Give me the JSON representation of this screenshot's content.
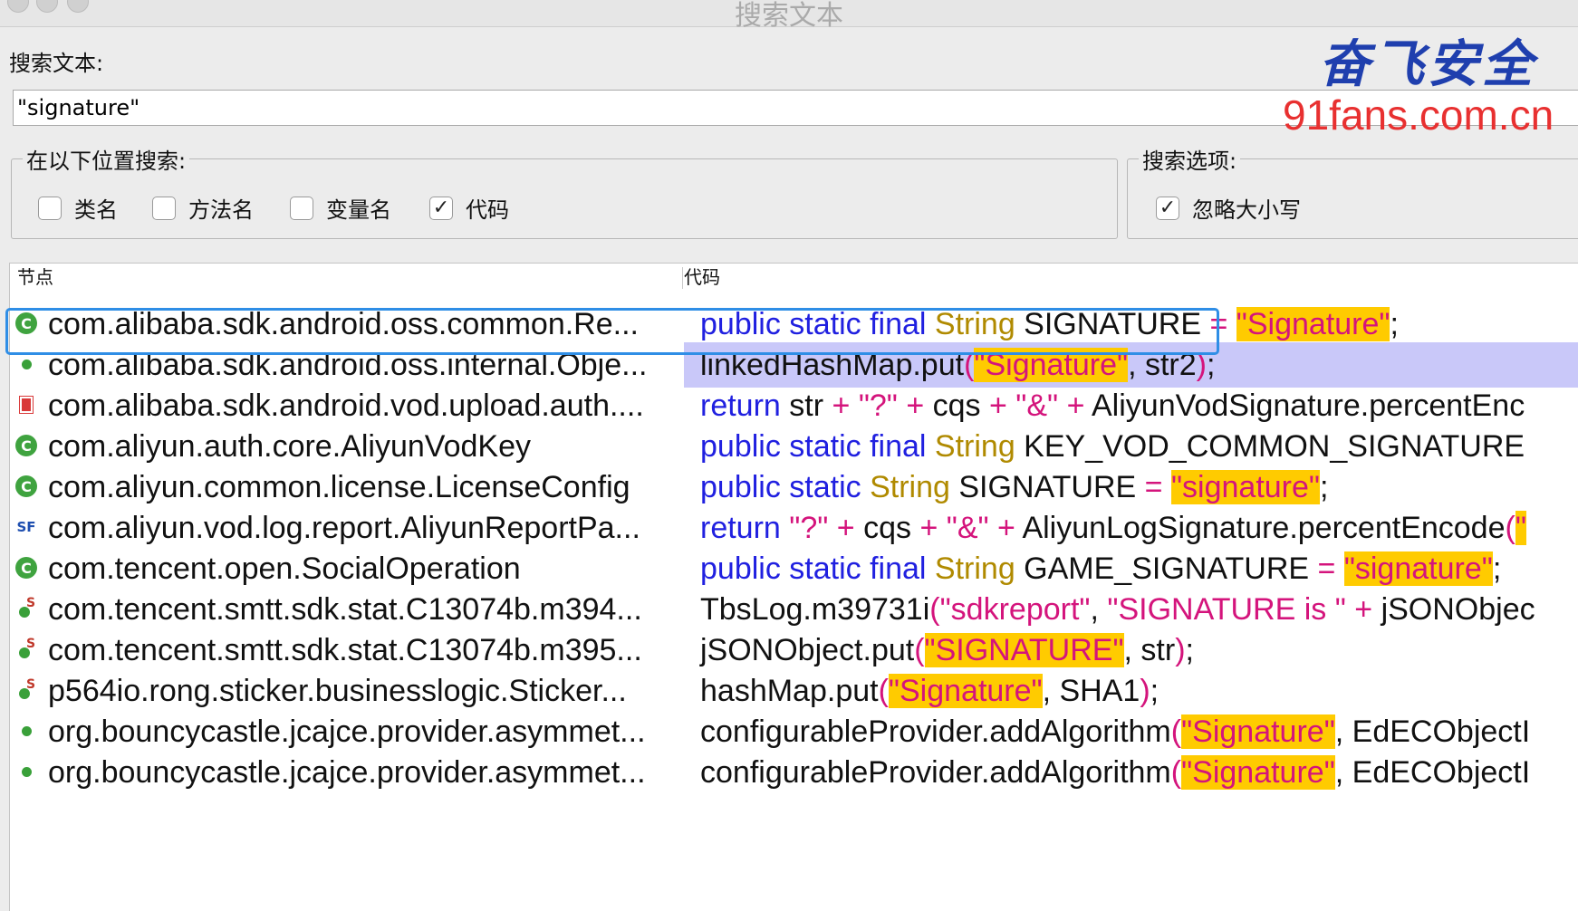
{
  "window": {
    "title": "搜索文本"
  },
  "search": {
    "label": "搜索文本:",
    "value": "\"signature\""
  },
  "watermark": {
    "brand": "奋飞安全",
    "url": "91fans.com.cn"
  },
  "locations": {
    "legend": "在以下位置搜索:",
    "options": [
      {
        "label": "类名",
        "checked": false
      },
      {
        "label": "方法名",
        "checked": false
      },
      {
        "label": "变量名",
        "checked": false
      },
      {
        "label": "代码",
        "checked": true
      }
    ]
  },
  "search_options": {
    "legend": "搜索选项:",
    "options": [
      {
        "label": "忽略大小写",
        "checked": true
      }
    ]
  },
  "colors": {
    "keyword": "#2020e0",
    "type": "#b08a00",
    "string": "#d4147c",
    "match_highlight": "#ffcb00",
    "selected_row": "#c9c8f9",
    "selection_outline": "#2f8ee6"
  },
  "results": {
    "headers": {
      "node": "节点",
      "code": "代码"
    },
    "check_mark": "✓",
    "rows": [
      {
        "node": "com.alibaba.sdk.android.oss.common.Re...",
        "icon": "class-icon",
        "code": [
          [
            "kw",
            "public static final "
          ],
          [
            "type",
            "String"
          ],
          [
            "plain",
            " SIGNATURE "
          ],
          [
            "op",
            "= "
          ],
          [
            "strhl",
            "\"Signature\""
          ],
          [
            "plain",
            ";"
          ]
        ]
      },
      {
        "node": "com.alibaba.sdk.android.oss.internal.Obje...",
        "icon": "method-icon",
        "selected": true,
        "code": [
          [
            "plain",
            "linkedHashMap.put"
          ],
          [
            "op",
            "("
          ],
          [
            "strhl",
            "\"Signature\""
          ],
          [
            "plain",
            ", str2"
          ],
          [
            "op",
            ")"
          ],
          [
            "plain",
            ";"
          ]
        ]
      },
      {
        "node": "com.alibaba.sdk.android.vod.upload.auth....",
        "icon": "private-method-icon",
        "code": [
          [
            "kw",
            "return"
          ],
          [
            "plain",
            " str "
          ],
          [
            "op",
            "+ "
          ],
          [
            "str",
            "\"?\""
          ],
          [
            "op",
            " + "
          ],
          [
            "plain",
            "cqs "
          ],
          [
            "op",
            "+ "
          ],
          [
            "str",
            "\"&\""
          ],
          [
            "op",
            " + "
          ],
          [
            "plain",
            "AliyunVodSignature.percentEnc"
          ]
        ]
      },
      {
        "node": "com.aliyun.auth.core.AliyunVodKey",
        "icon": "class-icon",
        "code": [
          [
            "kw",
            "public static final "
          ],
          [
            "type",
            "String"
          ],
          [
            "plain",
            " KEY_VOD_COMMON_SIGNATURE"
          ]
        ]
      },
      {
        "node": "com.aliyun.common.license.LicenseConfig",
        "icon": "class-icon",
        "code": [
          [
            "kw",
            "public static "
          ],
          [
            "type",
            "String"
          ],
          [
            "plain",
            " SIGNATURE "
          ],
          [
            "op",
            "= "
          ],
          [
            "strhl",
            "\"signature\""
          ],
          [
            "plain",
            ";"
          ]
        ]
      },
      {
        "node": "com.aliyun.vod.log.report.AliyunReportPa...",
        "icon": "static-field-icon",
        "code": [
          [
            "kw",
            "return "
          ],
          [
            "str",
            "\"?\""
          ],
          [
            "op",
            " + "
          ],
          [
            "plain",
            "cqs "
          ],
          [
            "op",
            "+ "
          ],
          [
            "str",
            "\"&\""
          ],
          [
            "op",
            " + "
          ],
          [
            "plain",
            "AliyunLogSignature.percentEncode"
          ],
          [
            "op",
            "("
          ],
          [
            "strhl",
            "\""
          ]
        ]
      },
      {
        "node": "com.tencent.open.SocialOperation",
        "icon": "class-icon",
        "code": [
          [
            "kw",
            "public static final "
          ],
          [
            "type",
            "String"
          ],
          [
            "plain",
            " GAME_SIGNATURE "
          ],
          [
            "op",
            "= "
          ],
          [
            "strhl",
            "\"signature\""
          ],
          [
            "plain",
            ";"
          ]
        ]
      },
      {
        "node": "com.tencent.smtt.sdk.stat.C13074b.m394...",
        "icon": "static-method-icon",
        "code": [
          [
            "plain",
            "TbsLog.m39731i"
          ],
          [
            "op",
            "("
          ],
          [
            "str",
            "\"sdkreport\""
          ],
          [
            "plain",
            ", "
          ],
          [
            "str",
            "\"SIGNATURE is \""
          ],
          [
            "op",
            " + "
          ],
          [
            "plain",
            "jSONObjec"
          ]
        ]
      },
      {
        "node": "com.tencent.smtt.sdk.stat.C13074b.m395...",
        "icon": "static-method-icon",
        "code": [
          [
            "plain",
            "jSONObject.put"
          ],
          [
            "op",
            "("
          ],
          [
            "strhl",
            "\"SIGNATURE\""
          ],
          [
            "plain",
            ", str"
          ],
          [
            "op",
            ")"
          ],
          [
            "plain",
            ";"
          ]
        ]
      },
      {
        "node": "p564io.rong.sticker.businesslogic.Sticker...",
        "icon": "static-method-icon",
        "code": [
          [
            "plain",
            "hashMap.put"
          ],
          [
            "op",
            "("
          ],
          [
            "strhl",
            "\"Signature\""
          ],
          [
            "plain",
            ", SHA1"
          ],
          [
            "op",
            ")"
          ],
          [
            "plain",
            ";"
          ]
        ]
      },
      {
        "node": "org.bouncycastle.jcajce.provider.asymmet...",
        "icon": "method-icon",
        "code": [
          [
            "plain",
            "configurableProvider.addAlgorithm"
          ],
          [
            "op",
            "("
          ],
          [
            "strhl",
            "\"Signature\""
          ],
          [
            "plain",
            ", EdECObjectI"
          ]
        ]
      },
      {
        "node": "org.bouncycastle.jcajce.provider.asymmet...",
        "icon": "method-icon",
        "code": [
          [
            "plain",
            "configurableProvider.addAlgorithm"
          ],
          [
            "op",
            "("
          ],
          [
            "strhl",
            "\"Signature\""
          ],
          [
            "plain",
            ", EdECObjectI"
          ]
        ]
      }
    ]
  }
}
